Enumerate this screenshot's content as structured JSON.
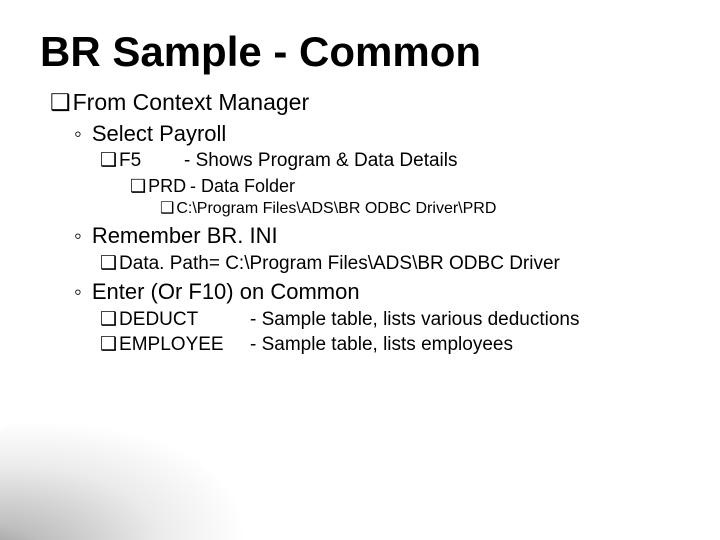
{
  "title": "BR Sample - Common",
  "bullets": {
    "from": {
      "marker": "❑",
      "text": "From Context Manager"
    },
    "select": {
      "marker": "◦",
      "text": "Select Payroll"
    },
    "f5": {
      "marker": "❑",
      "key": "F5",
      "desc": "- Shows Program & Data Details"
    },
    "prd": {
      "marker": "❑",
      "key": "PRD",
      "desc": "- Data Folder"
    },
    "prdpath": {
      "marker": "❑",
      "text": "C:\\Program Files\\ADS\\BR ODBC Driver\\PRD"
    },
    "remember": {
      "marker": "◦",
      "text": "Remember BR. INI"
    },
    "datapath": {
      "marker": "❑",
      "text": "Data. Path= C:\\Program Files\\ADS\\BR ODBC Driver"
    },
    "enter": {
      "marker": "◦",
      "text": "Enter (Or F10) on Common"
    },
    "deduct": {
      "marker": "❑",
      "key": "DEDUCT",
      "desc": "- Sample table, lists various deductions"
    },
    "employee": {
      "marker": "❑",
      "key": "EMPLOYEE",
      "desc": "- Sample table, lists employees"
    }
  }
}
